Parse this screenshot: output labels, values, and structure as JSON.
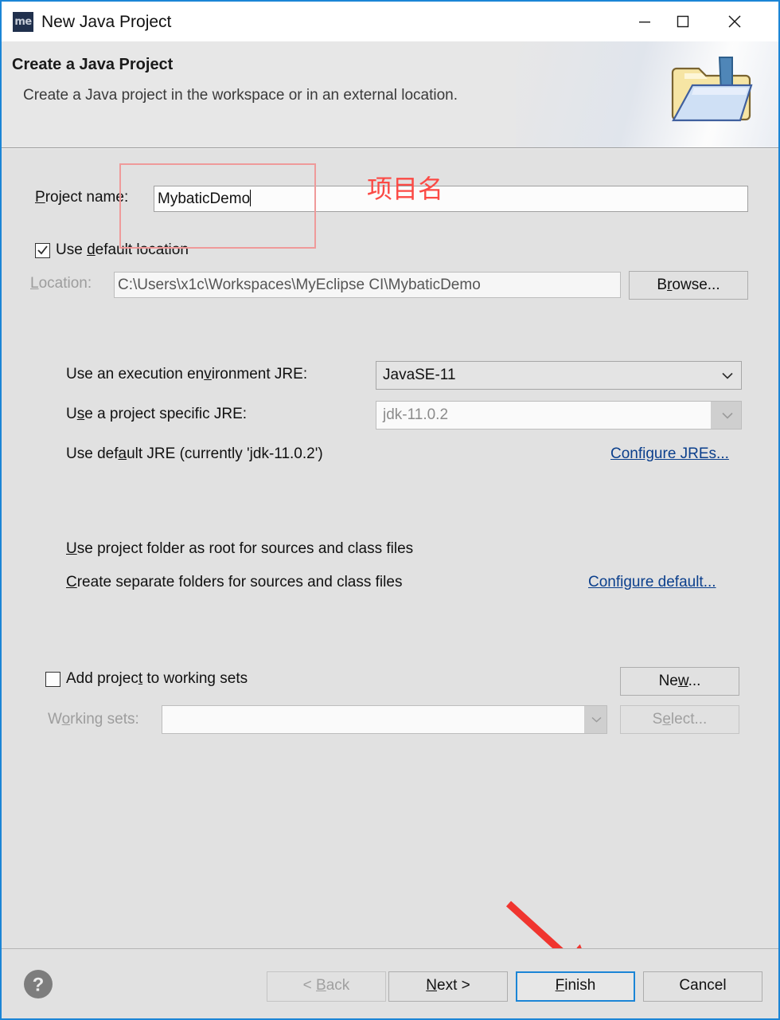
{
  "window": {
    "title": "New Java Project",
    "app_icon": "me",
    "controls": {
      "minimize": "minimize-icon",
      "maximize": "maximize-icon",
      "close": "close-icon"
    }
  },
  "header": {
    "title": "Create a Java Project",
    "subtitle": "Create a Java project in the workspace or in an external location.",
    "icon": "java-project-folder-icon"
  },
  "form": {
    "project_name_label": "Project name:",
    "project_name_value": "MybaticDemo",
    "use_default_location_label": "Use default location",
    "use_default_location_checked": true,
    "location_label": "Location:",
    "location_value": "C:\\Users\\x1c\\Workspaces\\MyEclipse CI\\MybaticDemo",
    "browse_label": "Browse...",
    "jre": {
      "execution_env_label": "Use an execution environment JRE:",
      "execution_env_value": "JavaSE-11",
      "project_specific_label": "Use a project specific JRE:",
      "project_specific_value": "jdk-11.0.2",
      "default_jre_label": "Use default JRE (currently 'jdk-11.0.2')",
      "configure_jres_link": "Configure JREs..."
    },
    "layout": {
      "project_folder_root_label": "Use project folder as root for sources and class files",
      "separate_folders_label": "Create separate folders for sources and class files",
      "configure_default_link": "Configure default..."
    },
    "working_sets": {
      "add_project_label": "Add project to working sets",
      "add_project_checked": false,
      "new_button": "New...",
      "working_sets_label": "Working sets:",
      "working_sets_value": "",
      "select_button": "Select..."
    }
  },
  "footer": {
    "help_icon": "help-icon",
    "back_label": "< Back",
    "next_label": "Next >",
    "finish_label": "Finish",
    "cancel_label": "Cancel"
  },
  "annotations": {
    "project_name_note": "项目名",
    "highlight_color": "#ef9a9a",
    "arrow_color": "#f0352f",
    "note_color": "#fb4a45"
  }
}
